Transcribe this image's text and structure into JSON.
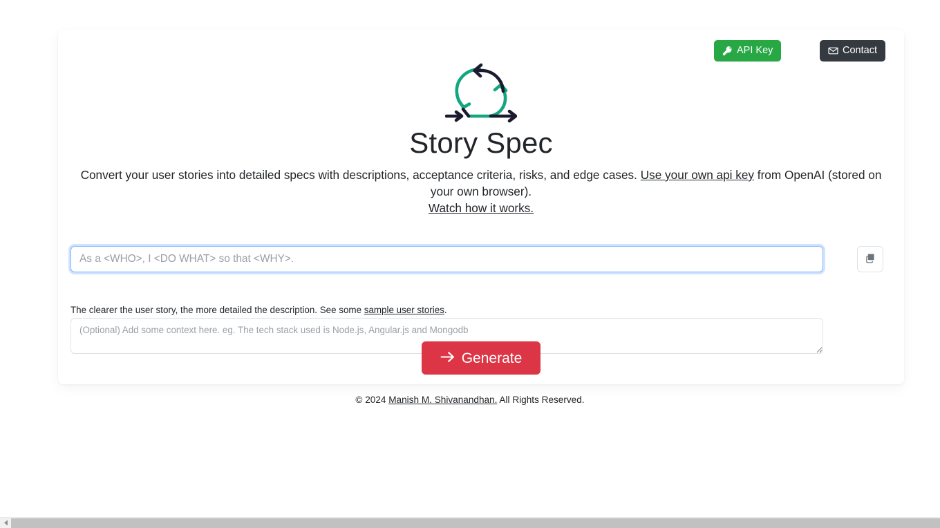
{
  "header": {
    "api_key_label": "API Key",
    "contact_label": "Contact",
    "api_key_color": "#28a745",
    "contact_color": "#343a40"
  },
  "logo": {
    "name": "cycle-arrows-logo",
    "green": "#13a67f",
    "dark": "#1b1b2f"
  },
  "hero": {
    "title": "Story Spec",
    "description_before_link": "Convert your user stories into detailed specs with descriptions, acceptance criteria, risks, and edge cases. ",
    "description_link": "Use your own api key",
    "description_after_link": " from OpenAI (stored on your own browser).",
    "watch_link": "Watch how it works."
  },
  "form": {
    "story_placeholder": "As a <WHO>, I <DO WHAT> so that <WHY>.",
    "story_value": "",
    "paste_button_title": "Paste",
    "helper_before_link": "The clearer the user story, the more detailed the description. See some ",
    "helper_link": "sample user stories",
    "helper_after_link": ".",
    "context_placeholder": "(Optional) Add some context here. eg. The tech stack used is Node.js, Angular.js and Mongodb",
    "context_value": "",
    "generate_label": "Generate",
    "generate_color": "#dc3545"
  },
  "footer": {
    "copyright": "© 2024 ",
    "author_link": "Manish M. Shivanandhan.",
    "rights": " All Rights Reserved."
  },
  "scrollbar": {
    "left_arrow": "◀"
  }
}
